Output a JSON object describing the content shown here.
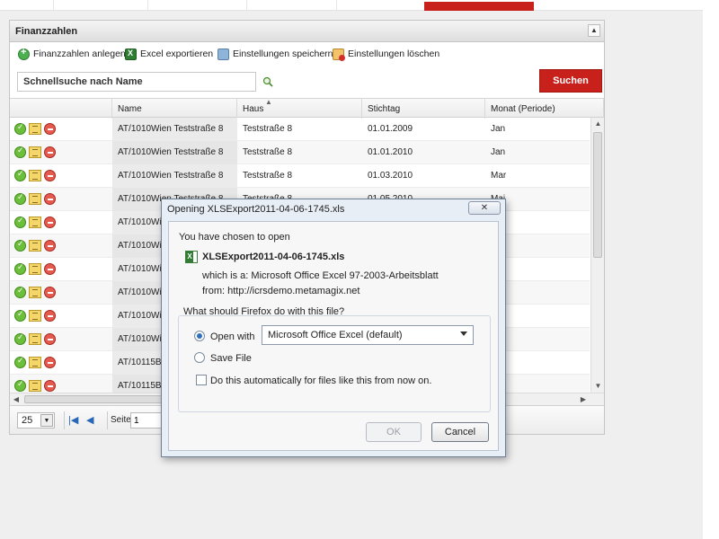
{
  "panel": {
    "title": "Finanzzahlen",
    "collapse_icon": "▲"
  },
  "toolbar": {
    "add_label": "Finanzzahlen anlegen",
    "export_label": "Excel exportieren",
    "save_settings_label": "Einstellungen speichern",
    "delete_settings_label": "Einstellungen löschen"
  },
  "search": {
    "value": "Schnellsuche nach Name",
    "button_label": "Suchen"
  },
  "grid": {
    "columns": [
      "Name",
      "Haus",
      "Stichtag",
      "Monat (Periode)"
    ],
    "rows": [
      {
        "name": "AT/1010Wien Teststraße 8",
        "haus": "Teststraße 8",
        "stichtag": "01.01.2009",
        "monat": "Jan"
      },
      {
        "name": "AT/1010Wien Teststraße 8",
        "haus": "Teststraße 8",
        "stichtag": "01.01.2010",
        "monat": "Jan"
      },
      {
        "name": "AT/1010Wien Teststraße 8",
        "haus": "Teststraße 8",
        "stichtag": "01.03.2010",
        "monat": "Mar"
      },
      {
        "name": "AT/1010Wien Teststraße 8",
        "haus": "Teststraße 8",
        "stichtag": "01.05.2010",
        "monat": "Mai"
      },
      {
        "name": "AT/1010Wien",
        "haus": "",
        "stichtag": "",
        "monat": ""
      },
      {
        "name": "AT/1010Wien",
        "haus": "",
        "stichtag": "",
        "monat": ""
      },
      {
        "name": "AT/1010Wien",
        "haus": "",
        "stichtag": "",
        "monat": ""
      },
      {
        "name": "AT/1010Wien",
        "haus": "",
        "stichtag": "",
        "monat": ""
      },
      {
        "name": "AT/1010Wien",
        "haus": "",
        "stichtag": "",
        "monat": ""
      },
      {
        "name": "AT/1010Wien",
        "haus": "",
        "stichtag": "",
        "monat": ""
      },
      {
        "name": "AT/10115Berli",
        "haus": "",
        "stichtag": "",
        "monat": ""
      },
      {
        "name": "AT/10115Berli",
        "haus": "",
        "stichtag": "",
        "monat": ""
      }
    ]
  },
  "pager": {
    "page_size": "25",
    "page_label": "Seite",
    "page_value": "1"
  },
  "dialog": {
    "title": "Opening XLSExport2011-04-06-1745.xls",
    "chosen_text": "You have chosen to open",
    "filename": "XLSExport2011-04-06-1745.xls",
    "which_is": "which is a:  Microsoft Office Excel 97-2003-Arbeitsblatt",
    "from": "from:  http://icrsdemo.metamagix.net",
    "question": "What should Firefox do with this file?",
    "open_with_label": "Open with",
    "open_with_value": "Microsoft Office Excel (default)",
    "save_file_label": "Save File",
    "auto_label": "Do this automatically for files like this from now on.",
    "ok_label": "OK",
    "cancel_label": "Cancel"
  }
}
